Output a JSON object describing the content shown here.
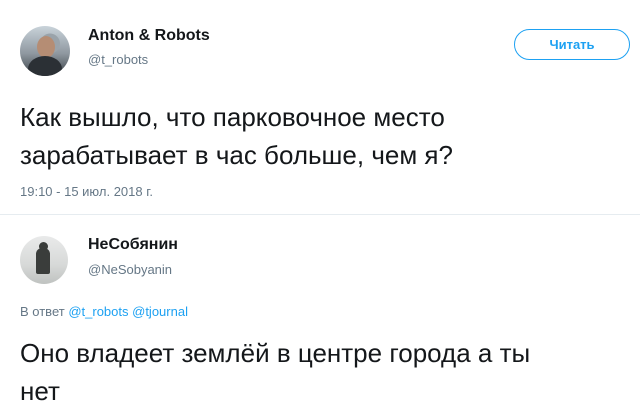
{
  "tweet1": {
    "author_name": "Anton & Robots",
    "author_handle": "@t_robots",
    "follow_label": "Читать",
    "text_line1": "Как вышло, что парковочное место",
    "text_line2": "зарабатывает в час больше, чем я?",
    "timestamp": "19:10 - 15 июл. 2018 г."
  },
  "tweet2": {
    "author_name": "НеСобянин",
    "author_handle": "@NeSobyanin",
    "reply_prefix": "В ответ",
    "reply_mention1": "@t_robots",
    "reply_mention2": "@tjournal",
    "text_line1": "Оно владеет землёй в центре города а ты",
    "text_line2": "нет"
  },
  "colors": {
    "accent": "#1da1f2",
    "text_primary": "#14171a",
    "text_secondary": "#657786",
    "divider": "#e6ecf0"
  },
  "icons": [
    "avatar-anton-robots",
    "avatar-nesobyanin"
  ]
}
